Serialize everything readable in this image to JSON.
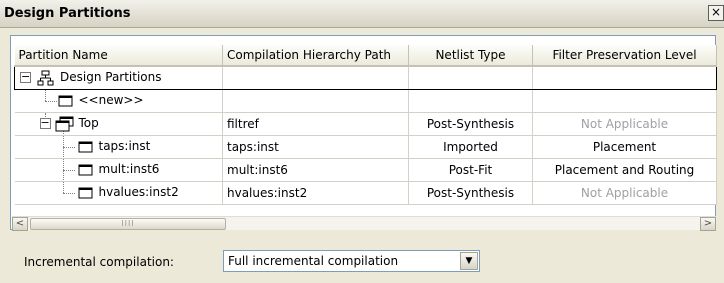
{
  "window": {
    "title": "Design Partitions",
    "close_icon": "×"
  },
  "columns": [
    "Partition Name",
    "Compilation Hierarchy Path",
    "Netlist Type",
    "Filter Preservation Level"
  ],
  "rows": [
    {
      "name": "Design Partitions",
      "path": "",
      "netlist": "",
      "level": "",
      "icon": "hierarchy-icon"
    },
    {
      "name": "<<new>>",
      "path": "",
      "netlist": "",
      "level": "",
      "icon": "partition-icon"
    },
    {
      "name": "Top",
      "path": "filtref",
      "netlist": "Post-Synthesis",
      "level": "Not Applicable",
      "level_disabled": true,
      "icon": "top-partition-icon"
    },
    {
      "name": "taps:inst",
      "path": "taps:inst",
      "netlist": "Imported",
      "level": "Placement",
      "icon": "partition-icon"
    },
    {
      "name": "mult:inst6",
      "path": "mult:inst6",
      "netlist": "Post-Fit",
      "level": "Placement and Routing",
      "icon": "partition-icon"
    },
    {
      "name": "hvalues:inst2",
      "path": "hvalues:inst2",
      "netlist": "Post-Synthesis",
      "level": "Not Applicable",
      "level_disabled": true,
      "icon": "partition-icon"
    }
  ],
  "scrollbar": {
    "left_arrow": "<",
    "right_arrow": ">",
    "thumb_grip": "IIII"
  },
  "incremental": {
    "label": "Incremental compilation:",
    "value": "Full incremental compilation",
    "arrow": "▼"
  },
  "tree": {
    "collapse_symbol": "−"
  },
  "colors": {
    "disabled_text": "#a0a0a0",
    "border": "#7f9db9",
    "background": "#ece9d8"
  }
}
